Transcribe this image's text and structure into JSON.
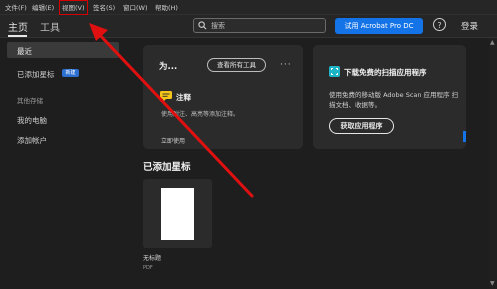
{
  "menu": {
    "items": [
      "文件(F)",
      "编辑(E)",
      "视图(V)",
      "签名(S)",
      "窗口(W)",
      "帮助(H)"
    ]
  },
  "toolbar": {
    "tab_home": "主页",
    "tab_tools": "工具",
    "search_placeholder": "搜索",
    "trial_label": "试用 Acrobat Pro DC",
    "help_label": "?",
    "login_label": "登录"
  },
  "sidebar": {
    "recent": "最近",
    "starred": "已添加星标",
    "new_badge": "新建",
    "section_storage": "其他存储",
    "my_computer": "我的电脑",
    "add_account": "添加帐户"
  },
  "tools_card": {
    "title": "为...",
    "view_all_label": "查看所有工具",
    "more": "···",
    "tool_name": "注释",
    "tool_desc": "使用附注、高亮等添加注释。",
    "tool_link": "立即使用"
  },
  "scan_card": {
    "title": "下载免费的扫描应用程序",
    "desc": "使用免费的移动版 Adobe Scan 应用程序 扫描文档、收据等。",
    "button_label": "获取应用程序"
  },
  "starred_section": {
    "title": "已添加星标",
    "file_name": "无标题",
    "file_type": "PDF"
  },
  "colors": {
    "accent": "#1473e6",
    "highlight": "#d40000",
    "background": "#1e1e1e",
    "card": "#2b2b2b"
  }
}
